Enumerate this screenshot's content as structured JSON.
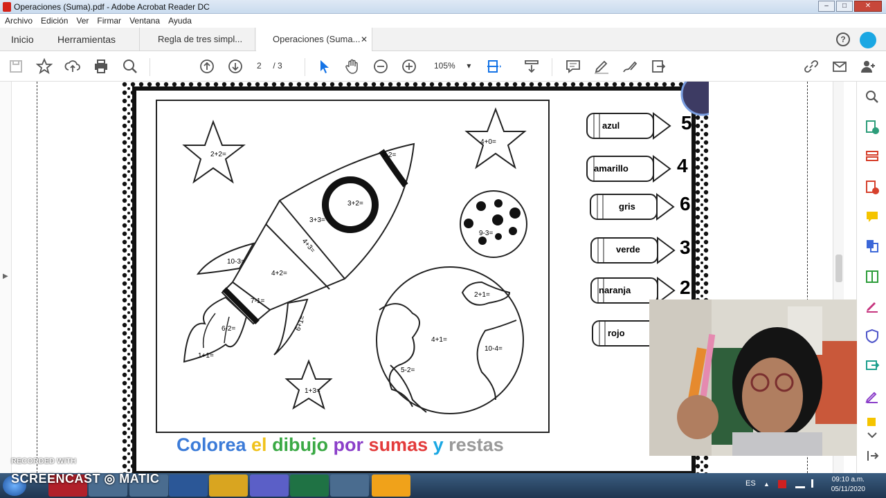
{
  "window": {
    "title": "Operaciones (Suma).pdf - Adobe Acrobat Reader DC",
    "min": "–",
    "max": "□",
    "close": "✕"
  },
  "menu": [
    "Archivo",
    "Edición",
    "Ver",
    "Firmar",
    "Ventana",
    "Ayuda"
  ],
  "tabs": {
    "home": "Inicio",
    "tools": "Herramientas",
    "doc1": "Regla de tres simpl...",
    "doc2": "Operaciones (Suma...",
    "close": "✕"
  },
  "help": "?",
  "toolbar": {
    "page_current": "2",
    "page_total": "/ 3",
    "zoom": "105%",
    "icons": [
      "save-icon",
      "bookmark-star-icon",
      "upload-icon",
      "print-icon",
      "search-icon",
      "page-up-icon",
      "page-down-icon",
      "select-cursor-icon",
      "hand-icon",
      "zoom-out-icon",
      "zoom-in-icon",
      "fit-page-icon",
      "scroll-mode-icon",
      "comment-icon",
      "highlight-pen-icon",
      "sign-icon",
      "share-icon",
      "link-icon",
      "mail-icon",
      "add-user-icon"
    ]
  },
  "worksheet": {
    "star1": "2+2=",
    "star2": "4+0=",
    "star3": "1+3=",
    "rocket_tip": "9-2=",
    "rocket_window": "3+2=",
    "rocket_band1": "3+3=",
    "rocket_band2": "4+3=",
    "rocket_body": "4+2=",
    "fin_left": "10-3=",
    "fin_right": "6+1=",
    "rocket_base": "7-1=",
    "flame1": "6-2=",
    "flame2": "1+1=",
    "moon": "9-3=",
    "earth1": "2+1=",
    "earth2": "4+1=",
    "earth3": "10-4=",
    "earth4": "5-2="
  },
  "legend": [
    {
      "label": "azul",
      "number": "5"
    },
    {
      "label": "amarillo",
      "number": "4"
    },
    {
      "label": "gris",
      "number": "6"
    },
    {
      "label": "verde",
      "number": "3"
    },
    {
      "label": "naranja",
      "number": "2"
    },
    {
      "label": "rojo",
      "number": ""
    }
  ],
  "caption": [
    {
      "text": "Colorea ",
      "color": "#3b7bd8"
    },
    {
      "text": "el ",
      "color": "#f0c21b"
    },
    {
      "text": "dibujo ",
      "color": "#3aa944"
    },
    {
      "text": "por ",
      "color": "#8b3fc9"
    },
    {
      "text": "sumas ",
      "color": "#e33b3b"
    },
    {
      "text": "y ",
      "color": "#1aa7e3"
    },
    {
      "text": "restas",
      "color": "#999999"
    }
  ],
  "watermark": {
    "line1": "RECORDED WITH",
    "line2": "SCREENCAST ◎ MATIC"
  },
  "taskbar": {
    "language": "ES",
    "time": "09:10 a.m.",
    "date": "05/11/2020",
    "apps": [
      "acrobat",
      "chrome",
      "files",
      "word",
      "folder",
      "teams",
      "excel",
      "paint",
      "screencast"
    ]
  }
}
